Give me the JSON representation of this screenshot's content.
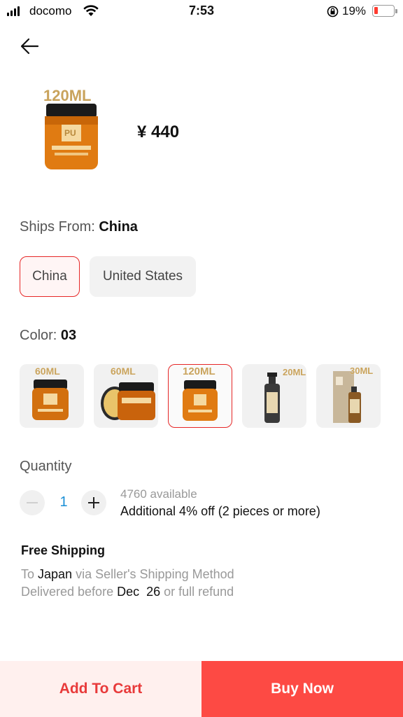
{
  "status_bar": {
    "carrier": "docomo",
    "time": "7:53",
    "battery_percent": "19%"
  },
  "product": {
    "image_label": "120ML",
    "price": "¥ 440"
  },
  "ships_from": {
    "label": "Ships From: ",
    "value": "China",
    "options": [
      "China",
      "United States"
    ],
    "selected": "China"
  },
  "color": {
    "label": "Color: ",
    "value": "03",
    "options": [
      {
        "tag": "60ML"
      },
      {
        "tag": "60ML"
      },
      {
        "tag": "120ML"
      },
      {
        "tag": "20ML"
      },
      {
        "tag": "30ML"
      }
    ],
    "selected_index": 2
  },
  "quantity": {
    "label": "Quantity",
    "value": "1",
    "available": "4760 available",
    "discount": "Additional 4% off (2 pieces or more)"
  },
  "shipping": {
    "title": "Free Shipping",
    "to_prefix": "To ",
    "country": "Japan",
    "via": " via Seller's Shipping Method",
    "delivered_prefix": "Delivered before ",
    "date": "Dec  26",
    "refund": " or full refund"
  },
  "actions": {
    "add_to_cart": "Add To Cart",
    "buy_now": "Buy Now"
  },
  "colors": {
    "accent_red": "#e62727",
    "buy_button": "#fd4a44",
    "cart_button_bg": "#fff0ee",
    "quantity_blue": "#1a8fd6"
  }
}
